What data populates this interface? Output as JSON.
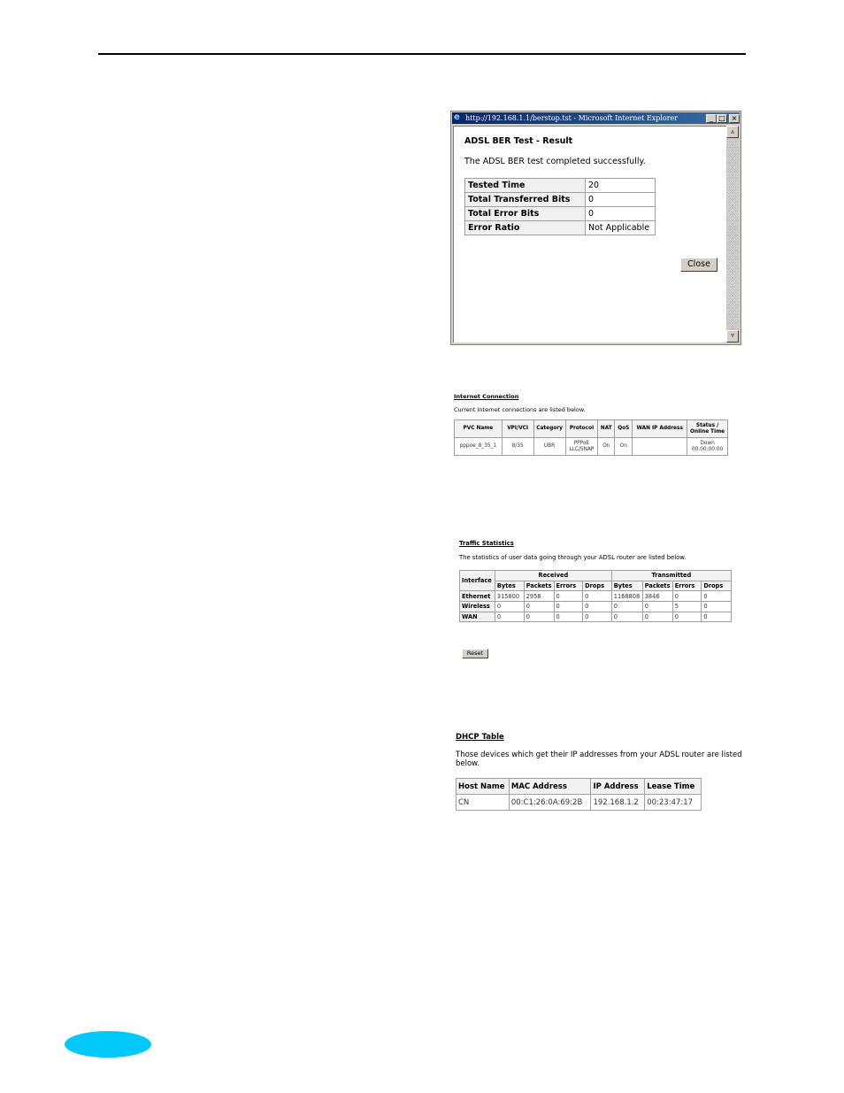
{
  "document": {
    "page_marker_color": "#00c8f8"
  },
  "ber_window": {
    "title": "http://192.168.1.1/berstop.tst - Microsoft Internet Explorer",
    "controls": {
      "minimize": "_",
      "maximize": "□",
      "close": "×"
    },
    "heading": "ADSL BER Test - Result",
    "message": "The ADSL BER test completed successfully.",
    "rows": [
      {
        "label": "Tested Time",
        "value": "20"
      },
      {
        "label": "Total Transferred Bits",
        "value": "0"
      },
      {
        "label": "Total Error Bits",
        "value": "0"
      },
      {
        "label": "Error Ratio",
        "value": "Not Applicable"
      }
    ],
    "close_label": "Close"
  },
  "internet_connection": {
    "title": "Internet Connection",
    "description": "Current Internet connections are listed below.",
    "headers": [
      "PVC Name",
      "VPI/VCI",
      "Category",
      "Protocol",
      "NAT",
      "QoS",
      "WAN IP Address",
      "Status / Online Time"
    ],
    "rows": [
      {
        "pvc_name": "pppoe_8_35_1",
        "vpi_vci": "8/35",
        "category": "UBR",
        "protocol_line1": "PPPoE",
        "protocol_line2": "LLC/SNAP",
        "nat": "On",
        "qos": "On",
        "wan_ip": "",
        "status": "Down",
        "online_time": "00:00:00:00"
      }
    ]
  },
  "traffic_statistics": {
    "title": "Traffic Statistics",
    "description": "The statistics of user data going through your ADSL router are listed below.",
    "interface_header": "Interface",
    "group_headers": [
      "Received",
      "Transmitted"
    ],
    "sub_headers": [
      "Bytes",
      "Packets",
      "Errors",
      "Drops",
      "Bytes",
      "Packets",
      "Errors",
      "Drops"
    ],
    "rows": [
      {
        "interface": "Ethernet",
        "values": [
          "315800",
          "2958",
          "0",
          "0",
          "1168808",
          "3846",
          "0",
          "0"
        ]
      },
      {
        "interface": "Wireless",
        "values": [
          "0",
          "0",
          "0",
          "0",
          "0",
          "0",
          "5",
          "0"
        ]
      },
      {
        "interface": "WAN",
        "values": [
          "0",
          "0",
          "0",
          "0",
          "0",
          "0",
          "0",
          "0"
        ]
      }
    ],
    "reset_label": "Reset"
  },
  "dhcp_table": {
    "title": "DHCP Table",
    "description": "Those devices which get their IP addresses from your ADSL router are listed below.",
    "headers": [
      "Host Name",
      "MAC Address",
      "IP Address",
      "Lease Time"
    ],
    "rows": [
      {
        "host_name": "CN",
        "mac": "00:C1:26:0A:69:2B",
        "ip": "192.168.1.2",
        "lease": "00:23:47:17"
      }
    ]
  }
}
